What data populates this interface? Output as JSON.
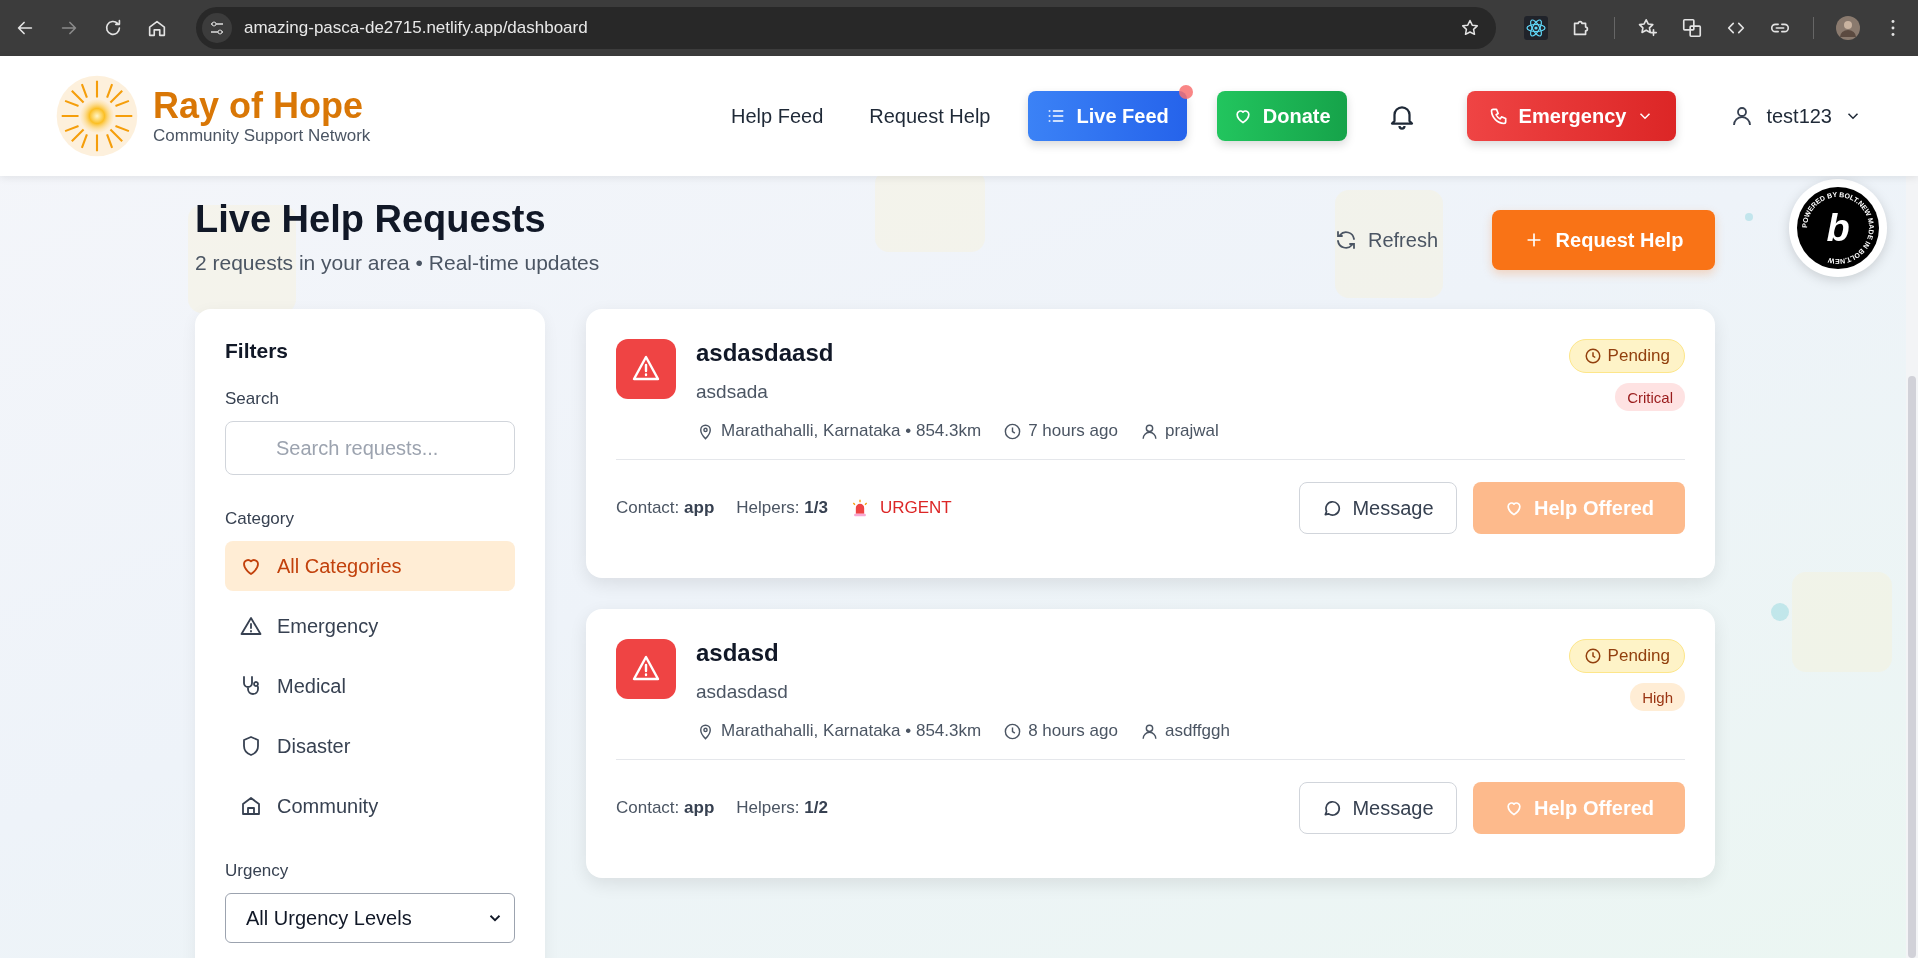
{
  "browser": {
    "url": "amazing-pasca-de2715.netlify.app/dashboard"
  },
  "header": {
    "brand": "Ray of Hope",
    "tagline": "Community Support Network",
    "nav": [
      {
        "kind": "link",
        "label": "Help Feed"
      },
      {
        "kind": "link",
        "label": "Request Help"
      },
      {
        "kind": "live",
        "label": "Live Feed",
        "notification": true
      },
      {
        "kind": "donate",
        "label": "Donate"
      },
      {
        "kind": "bell"
      },
      {
        "kind": "emergency",
        "label": "Emergency"
      },
      {
        "kind": "user",
        "label": "test123"
      }
    ]
  },
  "page": {
    "title": "Live Help Requests",
    "subtitle": "2 requests in your area • Real-time updates",
    "refresh": "Refresh",
    "request_button": "Request Help"
  },
  "filters": {
    "title": "Filters",
    "search_label": "Search",
    "search_placeholder": "Search requests...",
    "category_label": "Category",
    "categories": [
      {
        "kind": "heart",
        "label": "All Categories",
        "selected": true
      },
      {
        "kind": "warning",
        "label": "Emergency",
        "selected": false
      },
      {
        "kind": "stethoscope",
        "label": "Medical",
        "selected": false
      },
      {
        "kind": "shield",
        "label": "Disaster",
        "selected": false
      },
      {
        "kind": "home",
        "label": "Community",
        "selected": false
      }
    ],
    "urgency_label": "Urgency",
    "urgency_value": "All Urgency Levels"
  },
  "requests": [
    {
      "title": "asdasdaasd",
      "description": "asdsada",
      "location": "Marathahalli, Karnataka • 854.3km",
      "time": "7 hours ago",
      "user": "prajwal",
      "status": "Pending",
      "urgency": {
        "kind": "critical",
        "label": "Critical"
      },
      "contact": "Contact: **app**",
      "helpers": "Helpers: **1/3**",
      "flag": "URGENT",
      "message": "Message",
      "help": "Help Offered"
    },
    {
      "title": "asdasd",
      "description": "asdasdasd",
      "location": "Marathahalli, Karnataka • 854.3km",
      "time": "8 hours ago",
      "user": "asdffggh",
      "status": "Pending",
      "urgency": {
        "kind": "high",
        "label": "High"
      },
      "contact": "Contact: **app**",
      "helpers": "Helpers: **1/2**",
      "message": "Message",
      "help": "Help Offered"
    }
  ],
  "badge": {
    "ring": "POWERED BY BOLT.NEW MADE IN BOLT.NEW ",
    "letter": "b"
  }
}
